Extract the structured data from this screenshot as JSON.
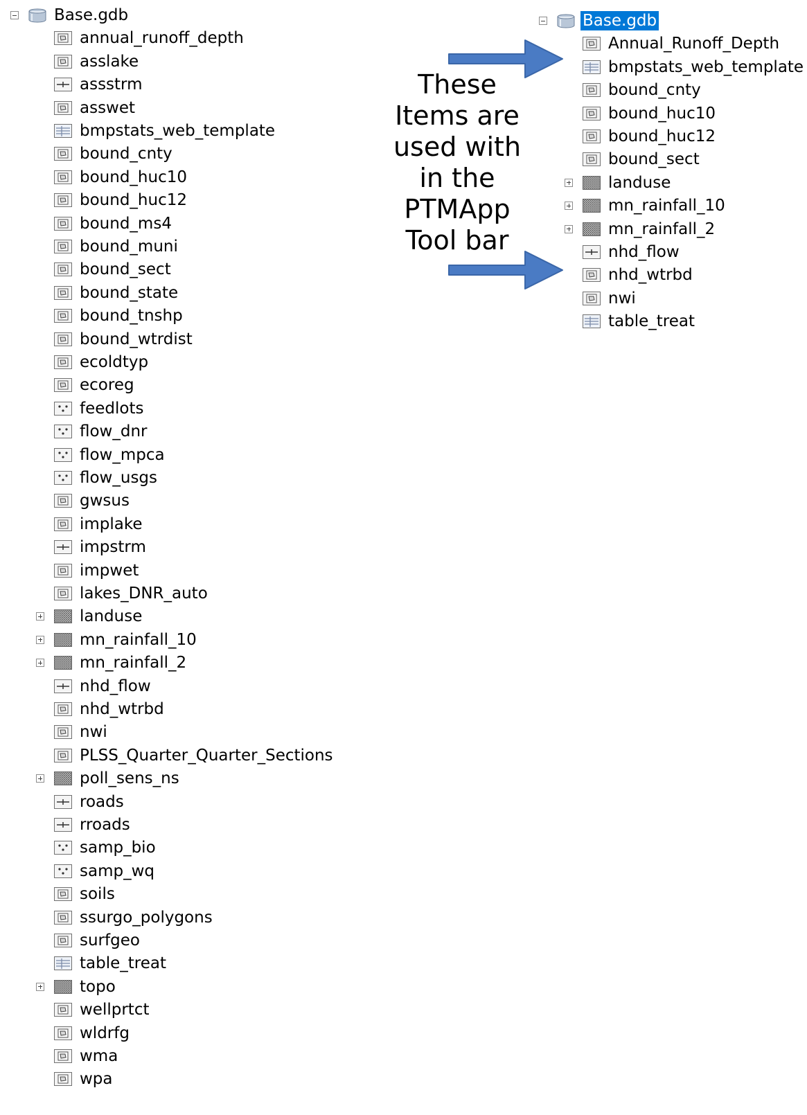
{
  "left_tree": {
    "root": "Base.gdb",
    "items": [
      {
        "label": "annual_runoff_depth",
        "icon": "polygon-feature-icon"
      },
      {
        "label": "asslake",
        "icon": "polygon-feature-icon"
      },
      {
        "label": "assstrm",
        "icon": "line-feature-icon"
      },
      {
        "label": "asswet",
        "icon": "polygon-feature-icon"
      },
      {
        "label": "bmpstats_web_template",
        "icon": "table-icon"
      },
      {
        "label": "bound_cnty",
        "icon": "polygon-feature-icon"
      },
      {
        "label": "bound_huc10",
        "icon": "polygon-feature-icon"
      },
      {
        "label": "bound_huc12",
        "icon": "polygon-feature-icon"
      },
      {
        "label": "bound_ms4",
        "icon": "polygon-feature-icon"
      },
      {
        "label": "bound_muni",
        "icon": "polygon-feature-icon"
      },
      {
        "label": "bound_sect",
        "icon": "polygon-feature-icon"
      },
      {
        "label": "bound_state",
        "icon": "polygon-feature-icon"
      },
      {
        "label": "bound_tnshp",
        "icon": "polygon-feature-icon"
      },
      {
        "label": "bound_wtrdist",
        "icon": "polygon-feature-icon"
      },
      {
        "label": "ecoldtyp",
        "icon": "polygon-feature-icon"
      },
      {
        "label": "ecoreg",
        "icon": "polygon-feature-icon"
      },
      {
        "label": "feedlots",
        "icon": "point-feature-icon"
      },
      {
        "label": "flow_dnr",
        "icon": "point-feature-icon"
      },
      {
        "label": "flow_mpca",
        "icon": "point-feature-icon"
      },
      {
        "label": "flow_usgs",
        "icon": "point-feature-icon"
      },
      {
        "label": "gwsus",
        "icon": "polygon-feature-icon"
      },
      {
        "label": "implake",
        "icon": "polygon-feature-icon"
      },
      {
        "label": "impstrm",
        "icon": "line-feature-icon"
      },
      {
        "label": "impwet",
        "icon": "polygon-feature-icon"
      },
      {
        "label": "lakes_DNR_auto",
        "icon": "polygon-feature-icon"
      },
      {
        "label": "landuse",
        "icon": "raster-icon",
        "expandable": true
      },
      {
        "label": "mn_rainfall_10",
        "icon": "raster-icon",
        "expandable": true
      },
      {
        "label": "mn_rainfall_2",
        "icon": "raster-icon",
        "expandable": true
      },
      {
        "label": "nhd_flow",
        "icon": "line-feature-icon"
      },
      {
        "label": "nhd_wtrbd",
        "icon": "polygon-feature-icon"
      },
      {
        "label": "nwi",
        "icon": "polygon-feature-icon"
      },
      {
        "label": "PLSS_Quarter_Quarter_Sections",
        "icon": "polygon-feature-icon"
      },
      {
        "label": "poll_sens_ns",
        "icon": "raster-icon",
        "expandable": true
      },
      {
        "label": "roads",
        "icon": "line-feature-icon"
      },
      {
        "label": "rroads",
        "icon": "line-feature-icon"
      },
      {
        "label": "samp_bio",
        "icon": "point-feature-icon"
      },
      {
        "label": "samp_wq",
        "icon": "point-feature-icon"
      },
      {
        "label": "soils",
        "icon": "polygon-feature-icon"
      },
      {
        "label": "ssurgo_polygons",
        "icon": "polygon-feature-icon"
      },
      {
        "label": "surfgeo",
        "icon": "polygon-feature-icon"
      },
      {
        "label": "table_treat",
        "icon": "table-icon"
      },
      {
        "label": "topo",
        "icon": "raster-icon",
        "expandable": true
      },
      {
        "label": "wellprtct",
        "icon": "polygon-feature-icon"
      },
      {
        "label": "wldrfg",
        "icon": "polygon-feature-icon"
      },
      {
        "label": "wma",
        "icon": "polygon-feature-icon"
      },
      {
        "label": "wpa",
        "icon": "polygon-feature-icon"
      }
    ]
  },
  "right_tree": {
    "root": "Base.gdb",
    "root_selected": true,
    "items": [
      {
        "label": "Annual_Runoff_Depth",
        "icon": "polygon-feature-icon"
      },
      {
        "label": "bmpstats_web_template",
        "icon": "table-icon"
      },
      {
        "label": "bound_cnty",
        "icon": "polygon-feature-icon"
      },
      {
        "label": "bound_huc10",
        "icon": "polygon-feature-icon"
      },
      {
        "label": "bound_huc12",
        "icon": "polygon-feature-icon"
      },
      {
        "label": "bound_sect",
        "icon": "polygon-feature-icon"
      },
      {
        "label": "landuse",
        "icon": "raster-icon",
        "expandable": true
      },
      {
        "label": "mn_rainfall_10",
        "icon": "raster-icon",
        "expandable": true
      },
      {
        "label": "mn_rainfall_2",
        "icon": "raster-icon",
        "expandable": true
      },
      {
        "label": "nhd_flow",
        "icon": "line-feature-icon"
      },
      {
        "label": "nhd_wtrbd",
        "icon": "polygon-feature-icon"
      },
      {
        "label": "nwi",
        "icon": "polygon-feature-icon"
      },
      {
        "label": "table_treat",
        "icon": "table-icon"
      }
    ]
  },
  "annotation": {
    "lines": [
      "These",
      "Items are",
      "used with",
      "in the",
      "PTMApp",
      "Tool bar"
    ]
  },
  "colors": {
    "arrow": "#4a7bc4",
    "selection": "#0078d7"
  }
}
